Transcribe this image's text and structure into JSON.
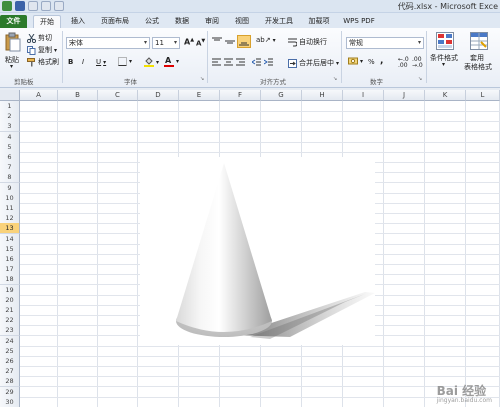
{
  "window": {
    "title": "代码.xlsx - Microsoft Exce"
  },
  "tabs": [
    {
      "label": "文件"
    },
    {
      "label": "开始"
    },
    {
      "label": "插入"
    },
    {
      "label": "页面布局"
    },
    {
      "label": "公式"
    },
    {
      "label": "数据"
    },
    {
      "label": "审阅"
    },
    {
      "label": "视图"
    },
    {
      "label": "开发工具"
    },
    {
      "label": "加载项"
    },
    {
      "label": "WPS PDF"
    }
  ],
  "ribbon": {
    "clipboard": {
      "paste_label": "粘贴",
      "cut_label": "剪切",
      "copy_label": "复制",
      "format_painter_label": "格式刷",
      "group_label": "剪贴板"
    },
    "font": {
      "font_name": "宋体",
      "font_size": "11",
      "bold": "B",
      "italic": "I",
      "underline": "U",
      "group_label": "字体"
    },
    "alignment": {
      "wrap_text_label": "自动换行",
      "merge_center_label": "合并后居中",
      "group_label": "对齐方式"
    },
    "number": {
      "format_value": "常规",
      "percent": "%",
      "comma": ",",
      "group_label": "数字"
    },
    "styles": {
      "conditional_format_label": "条件格式",
      "table_format_label_1": "套用",
      "table_format_label_2": "表格格式"
    }
  },
  "grid": {
    "columns": [
      "A",
      "B",
      "C",
      "D",
      "E",
      "F",
      "G",
      "H",
      "I",
      "J",
      "K",
      "L"
    ],
    "rows": [
      "1",
      "2",
      "3",
      "4",
      "5",
      "6",
      "7",
      "8",
      "9",
      "10",
      "11",
      "12",
      "13",
      "14",
      "15",
      "16",
      "17",
      "18",
      "19",
      "20",
      "21",
      "22",
      "23",
      "24",
      "25",
      "26",
      "27",
      "28",
      "29",
      "30"
    ],
    "selected_row": "13"
  },
  "watermark": {
    "text": "Bai 经验",
    "sub": "jingyan.baidu.com"
  },
  "colors": {
    "file_tab": "#2b7a2b",
    "selected_row_header": "#f9d27a",
    "ribbon_bg": "#e9eef6"
  }
}
